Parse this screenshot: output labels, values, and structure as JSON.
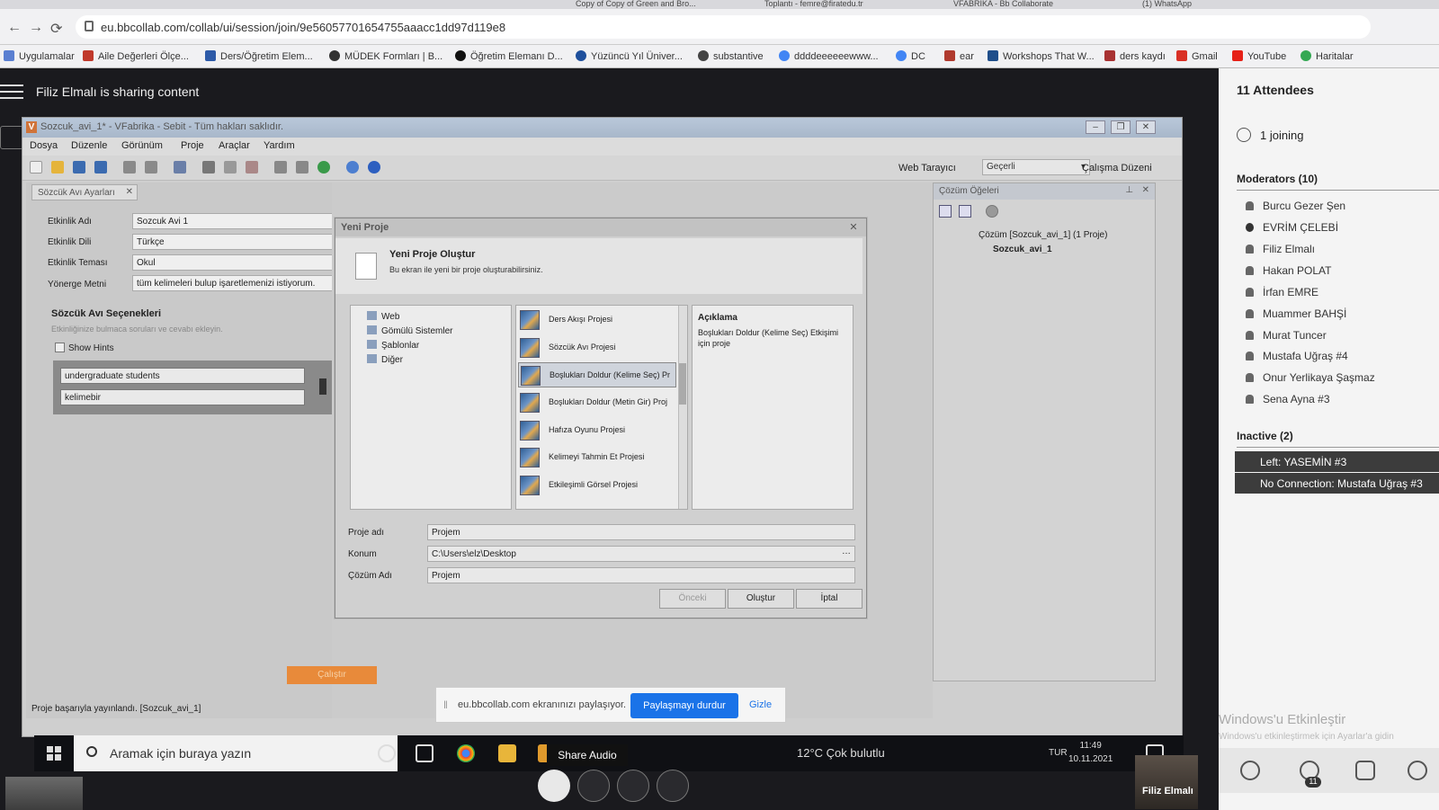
{
  "browser": {
    "tabs": [
      "Copy of Copy of Green and Bro...",
      "Toplantı - femre@firatedu.tr",
      "VFABRIKA - Bb Collaborate",
      "(1) WhatsApp"
    ],
    "url": "eu.bbcollab.com/collab/ui/session/join/9e56057701654755aaacc1dd97d119e8",
    "bookmarks": [
      "Uygulamalar",
      "Aile Değerleri Ölçe...",
      "Ders/Öğretim Elem...",
      "MÜDEK Formları | B...",
      "Öğretim Elemanı D...",
      "Yüzüncü Yıl Üniver...",
      "substantive",
      "ddddeeeeeewww...",
      "DC",
      "ear",
      "Workshops That W...",
      "ders kaydı",
      "Gmail",
      "YouTube",
      "Haritalar"
    ]
  },
  "collab": {
    "sharing_text": "Filiz Elmalı is sharing content",
    "tooltip": "Share Audio",
    "presenter_name": "Filiz Elmalı"
  },
  "vf": {
    "title": "Sozcuk_avi_1* - VFabrika - Sebit - Tüm hakları saklıdır.",
    "menu": [
      "Dosya",
      "Düzenle",
      "Görünüm",
      "Proje",
      "Araçlar",
      "Yardım"
    ],
    "web_label": "Web Tarayıcı",
    "web_value": "Geçerli",
    "layout_label": "Çalışma Düzeni",
    "panel_tab": "Sözcük Avı Ayarları",
    "fields": [
      {
        "label": "Etkinlik Adı",
        "value": "Sozcuk Avi 1"
      },
      {
        "label": "Etkinlik Dili",
        "value": "Türkçe"
      },
      {
        "label": "Etkinlik Teması",
        "value": "Okul"
      },
      {
        "label": "Yönerge Metni",
        "value": "tüm kelimeleri bulup işaretlemenizi istiyorum."
      }
    ],
    "options_title": "Sözcük Avı Seçenekleri",
    "options_sub": "Etkinliğinize bulmaca soruları ve cevabı ekleyin.",
    "show_hints": "Show Hints",
    "words": [
      "undergraduate students",
      "kelimebir"
    ],
    "run_button": "Çalıştır",
    "status": "Proje başarıyla yayınlandı. [Sozcuk_avi_1]",
    "solution_panel": "Çözüm Öğeleri",
    "solution_root": "Çözüm [Sozcuk_avi_1] (1 Proje)",
    "solution_project": "Sozcuk_avi_1"
  },
  "dialog": {
    "title": "Yeni Proje",
    "heading": "Yeni Proje Oluştur",
    "subheading": "Bu ekran ile yeni bir proje oluşturabilirsiniz.",
    "tree": [
      "Web",
      "Gömülü Sistemler",
      "Şablonlar",
      "Diğer"
    ],
    "projects": [
      "Ders Akışı Projesi",
      "Sözcük Avı Projesi",
      "Boşlukları Doldur (Kelime Seç) Pr",
      "Boşlukları Doldur (Metin Gir) Proj",
      "Hafıza Oyunu Projesi",
      "Kelimeyi Tahmin Et Projesi",
      "Etkileşimli Görsel Projesi"
    ],
    "desc_title": "Açıklama",
    "desc_body": "Boşlukları Doldur (Kelime Seç) Etkişimi için proje",
    "name_label": "Proje adı",
    "name_value": "Projem",
    "location_label": "Konum",
    "location_value": "C:\\Users\\elz\\Desktop",
    "solution_label": "Çözüm Adı",
    "solution_value": "Projem",
    "btn_prev": "Önceki",
    "btn_create": "Oluştur",
    "btn_cancel": "İptal"
  },
  "notify": {
    "text": "eu.bbcollab.com ekranınızı paylaşıyor.",
    "stop": "Paylaşmayı durdur",
    "hide": "Gizle"
  },
  "taskbar": {
    "search": "Aramak için buraya yazın",
    "weather": "12°C  Çok bulutlu",
    "lang": "TUR",
    "time": "11:49",
    "date": "10.11.2021"
  },
  "attendees": {
    "title": "11 Attendees",
    "joining": "1 joining",
    "moderators_title": "Moderators (10)",
    "moderators": [
      "Burcu Gezer Şen",
      "EVRİM ÇELEBİ",
      "Filiz Elmalı",
      "Hakan POLAT",
      "İrfan EMRE",
      "Muammer BAHŞİ",
      "Murat Tuncer",
      "Mustafa Uğraş #4",
      "Onur Yerlikaya Şaşmaz",
      "Sena Ayna #3"
    ],
    "inactive_title": "Inactive (2)",
    "inactive": [
      "Left: YASEMİN #3",
      "No Connection: Mustafa Uğraş #3"
    ],
    "watermark": "Windows'u Etkinleştir",
    "watermark_sub": "Windows'u etkinleştirmek için Ayarlar'a gidin",
    "count_badge": "11"
  }
}
